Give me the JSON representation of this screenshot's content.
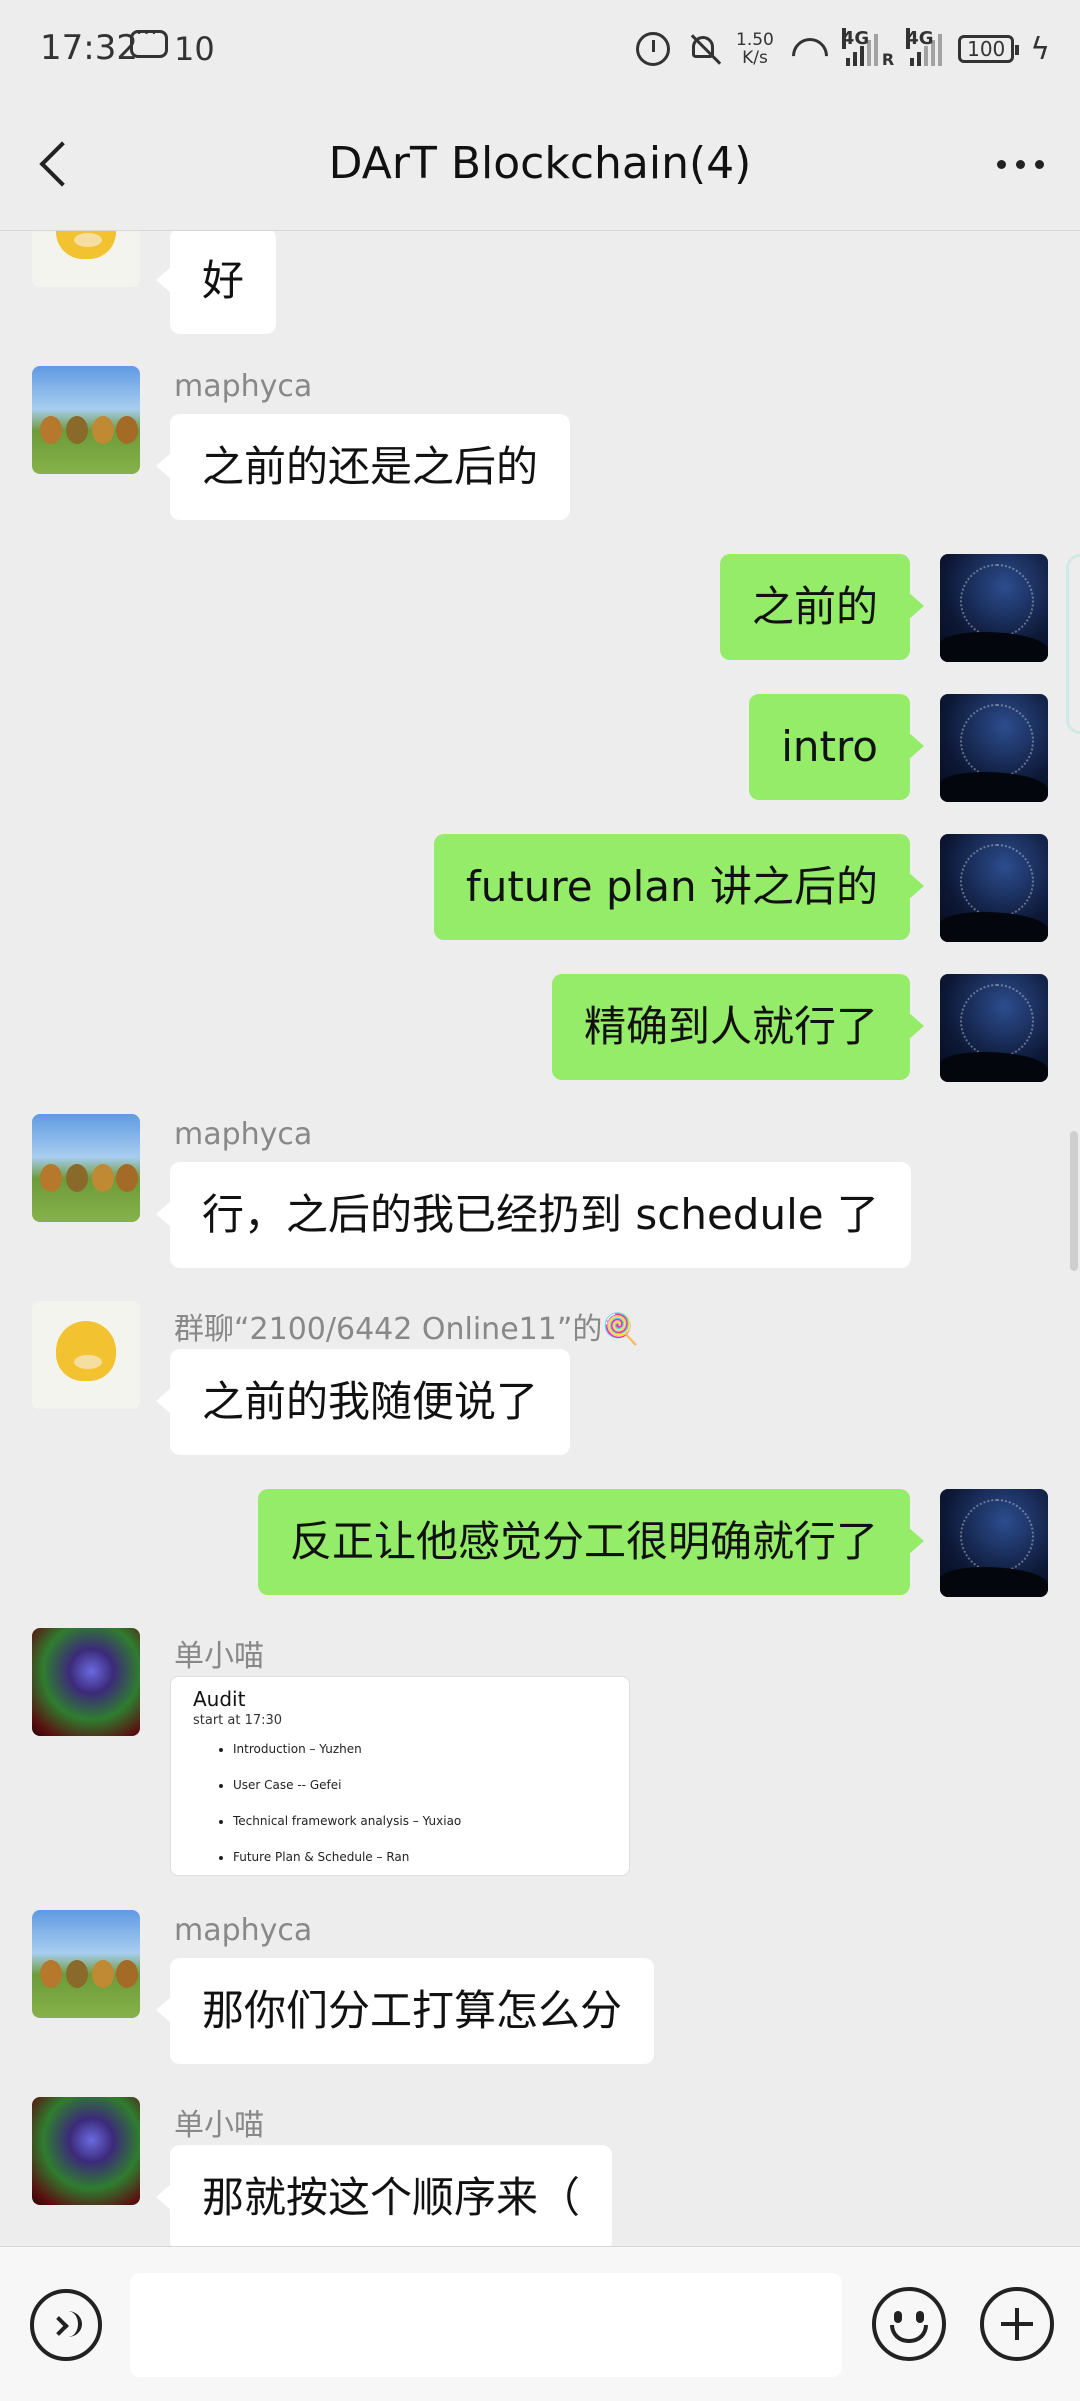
{
  "status_bar": {
    "time": "17:32",
    "notification_count": "10",
    "net_speed_value": "1.50",
    "net_speed_unit": "K/s",
    "sim1": "4G",
    "sim2": "4G",
    "sim2_roaming": "R",
    "battery": "100"
  },
  "header": {
    "title": "DArT Blockchain(4)"
  },
  "messages": [
    {
      "side": "in",
      "avatar": "psyduck-avatar",
      "text": "好"
    },
    {
      "side": "in",
      "sender": "maphyca",
      "avatar": "trees-avatar",
      "text": "之前的还是之后的"
    },
    {
      "side": "out",
      "avatar": "star-trails-avatar",
      "text": "之前的"
    },
    {
      "side": "out",
      "avatar": "star-trails-avatar",
      "text": "intro"
    },
    {
      "side": "out",
      "avatar": "star-trails-avatar",
      "text": "future plan 讲之后的"
    },
    {
      "side": "out",
      "avatar": "star-trails-avatar",
      "text": "精确到人就行了"
    },
    {
      "side": "in",
      "sender": "maphyca",
      "avatar": "trees-avatar",
      "text": "行，之后的我已经扔到 schedule 了"
    },
    {
      "side": "in",
      "sender": "群聊“2100/6442 Online11”的🍭",
      "avatar": "psyduck-avatar",
      "text": "之前的我随便说了"
    },
    {
      "side": "out",
      "avatar": "star-trails-avatar",
      "text": "反正让他感觉分工很明确就行了"
    },
    {
      "side": "in",
      "sender": "单小喵",
      "avatar": "abstract-avatar",
      "type": "image",
      "image": {
        "title": "Audit",
        "subtitle": "start at 17:30",
        "items": [
          "Introduction – Yuzhen",
          "User Case -- Gefei",
          "Technical framework analysis – Yuxiao",
          "Future Plan & Schedule – Ran"
        ]
      }
    },
    {
      "side": "in",
      "sender": "maphyca",
      "avatar": "trees-avatar",
      "text": "那你们分工打算怎么分"
    },
    {
      "side": "in",
      "sender": "单小喵",
      "avatar": "abstract-avatar",
      "text": "那就按这个顺序来（"
    }
  ],
  "input_bar": {
    "value": ""
  },
  "colors": {
    "background": "#ededed",
    "outgoing_bubble": "#95ec69",
    "incoming_bubble": "#ffffff"
  }
}
